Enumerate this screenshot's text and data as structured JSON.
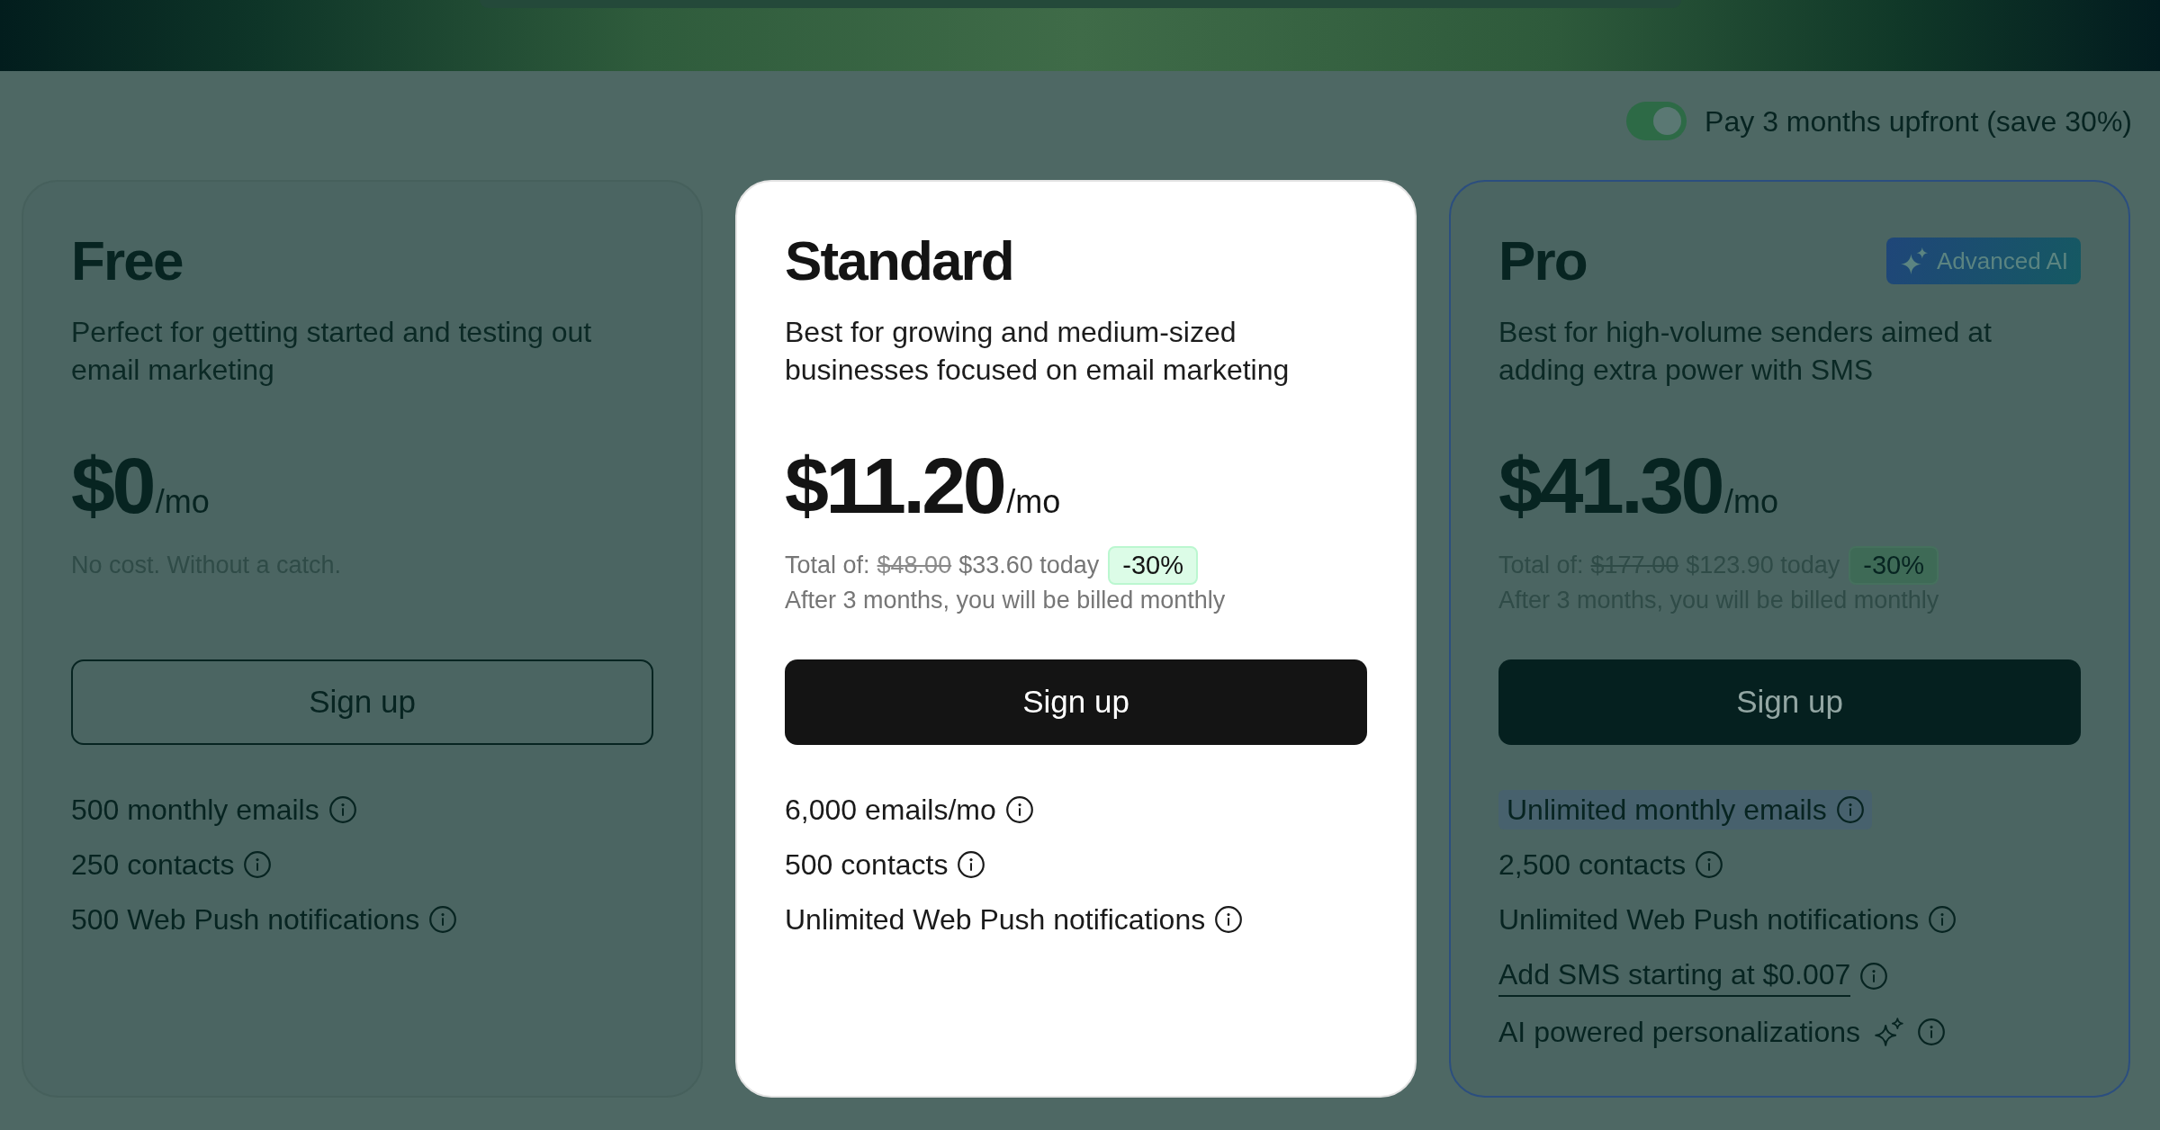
{
  "billing_toggle": {
    "label": "Pay 3 months upfront (save 30%)",
    "on": true
  },
  "plans": [
    {
      "name": "Free",
      "highlighted": false,
      "description": "Perfect for getting started and testing out email marketing",
      "price": "$0",
      "period": "/mo",
      "note": "No cost. Without a catch.",
      "button": {
        "label": "Sign up",
        "kind": "outline"
      },
      "features": [
        {
          "text": "500 monthly emails",
          "kind": "plain",
          "highlighted": false
        },
        {
          "text": "250 contacts",
          "kind": "plain",
          "highlighted": false
        },
        {
          "text": "500 Web Push notifications",
          "kind": "plain",
          "highlighted": false
        }
      ]
    },
    {
      "name": "Standard",
      "highlighted": true,
      "description": "Best for growing and medium-sized businesses focused on email marketing",
      "price": "$11.20",
      "period": "/mo",
      "total": {
        "label": "Total of:",
        "original": "$48.00",
        "current": "$33.60 today",
        "discount": "-30%"
      },
      "billing_note": "After 3 months, you will be billed monthly",
      "button": {
        "label": "Sign up",
        "kind": "solid"
      },
      "features": [
        {
          "text": "6,000 emails/mo",
          "kind": "plain",
          "highlighted": false
        },
        {
          "text": "500 contacts",
          "kind": "plain",
          "highlighted": false
        },
        {
          "text": "Unlimited Web Push notifications",
          "kind": "plain",
          "highlighted": false
        }
      ]
    },
    {
      "name": "Pro",
      "highlighted": false,
      "badge": "Advanced AI",
      "description": "Best for high-volume senders aimed at adding extra power with SMS",
      "price": "$41.30",
      "period": "/mo",
      "total": {
        "label": "Total of:",
        "original": "$177.00",
        "current": "$123.90 today",
        "discount": "-30%"
      },
      "billing_note": "After 3 months, you will be billed monthly",
      "button": {
        "label": "Sign up",
        "kind": "solid"
      },
      "features": [
        {
          "text": "Unlimited monthly emails",
          "kind": "plain",
          "highlighted": true
        },
        {
          "text": "2,500 contacts",
          "kind": "plain",
          "highlighted": false
        },
        {
          "text": "Unlimited Web Push notifications",
          "kind": "plain",
          "highlighted": false
        },
        {
          "text": "Add SMS starting at $0.007",
          "kind": "link",
          "highlighted": false
        },
        {
          "text": "AI powered personalizations",
          "kind": "ai",
          "highlighted": false
        }
      ]
    }
  ]
}
